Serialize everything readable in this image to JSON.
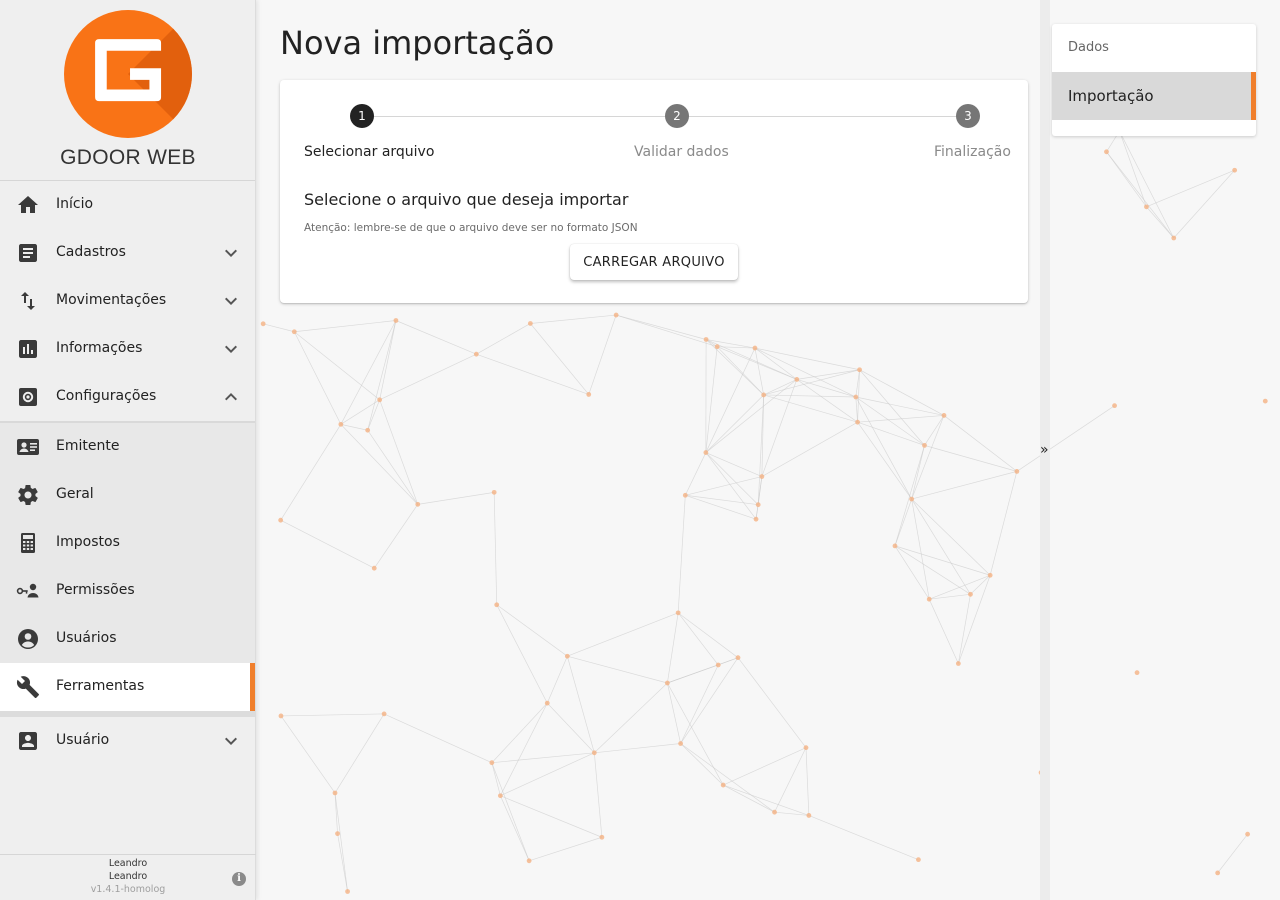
{
  "app": {
    "brand_name": "GDOOR WEB",
    "logo_letter": "G"
  },
  "colors": {
    "accent": "#f07f2c",
    "logo_orange": "#f97316"
  },
  "sidebar": {
    "items": [
      {
        "label": "Início",
        "icon": "home-icon"
      },
      {
        "label": "Cadastros",
        "icon": "list-icon",
        "chevron": "down"
      },
      {
        "label": "Movimentações",
        "icon": "swap-vertical-icon",
        "chevron": "down"
      },
      {
        "label": "Informações",
        "icon": "bar-chart-icon",
        "chevron": "down"
      },
      {
        "label": "Configurações",
        "icon": "settings-box-icon",
        "chevron": "up"
      }
    ],
    "submenu": [
      {
        "label": "Emitente",
        "icon": "id-card-icon"
      },
      {
        "label": "Geral",
        "icon": "gear-icon"
      },
      {
        "label": "Impostos",
        "icon": "calculator-icon"
      },
      {
        "label": "Permissões",
        "icon": "key-user-icon"
      },
      {
        "label": "Usuários",
        "icon": "user-circle-icon"
      },
      {
        "label": "Ferramentas",
        "icon": "wrench-icon",
        "active": true
      }
    ],
    "user_item": {
      "label": "Usuário",
      "icon": "account-box-icon",
      "chevron": "down"
    },
    "footer": {
      "user_line1": "Leandro",
      "user_line2": "Leandro",
      "version": "v1.4.1-homolog"
    }
  },
  "main": {
    "title": "Nova importação",
    "stepper": [
      {
        "number": "1",
        "label": "Selecionar arquivo",
        "active": true
      },
      {
        "number": "2",
        "label": "Validar dados",
        "active": false
      },
      {
        "number": "3",
        "label": "Finalização",
        "active": false
      }
    ],
    "heading": "Selecione o arquivo que deseja importar",
    "note": "Atenção: lembre-se de que o arquivo deve ser no formato JSON",
    "upload_button": "CARREGAR ARQUIVO"
  },
  "right_panel": {
    "toggle": "»",
    "items": [
      {
        "label": "Dados"
      },
      {
        "label": "Importação",
        "active": true
      }
    ]
  }
}
